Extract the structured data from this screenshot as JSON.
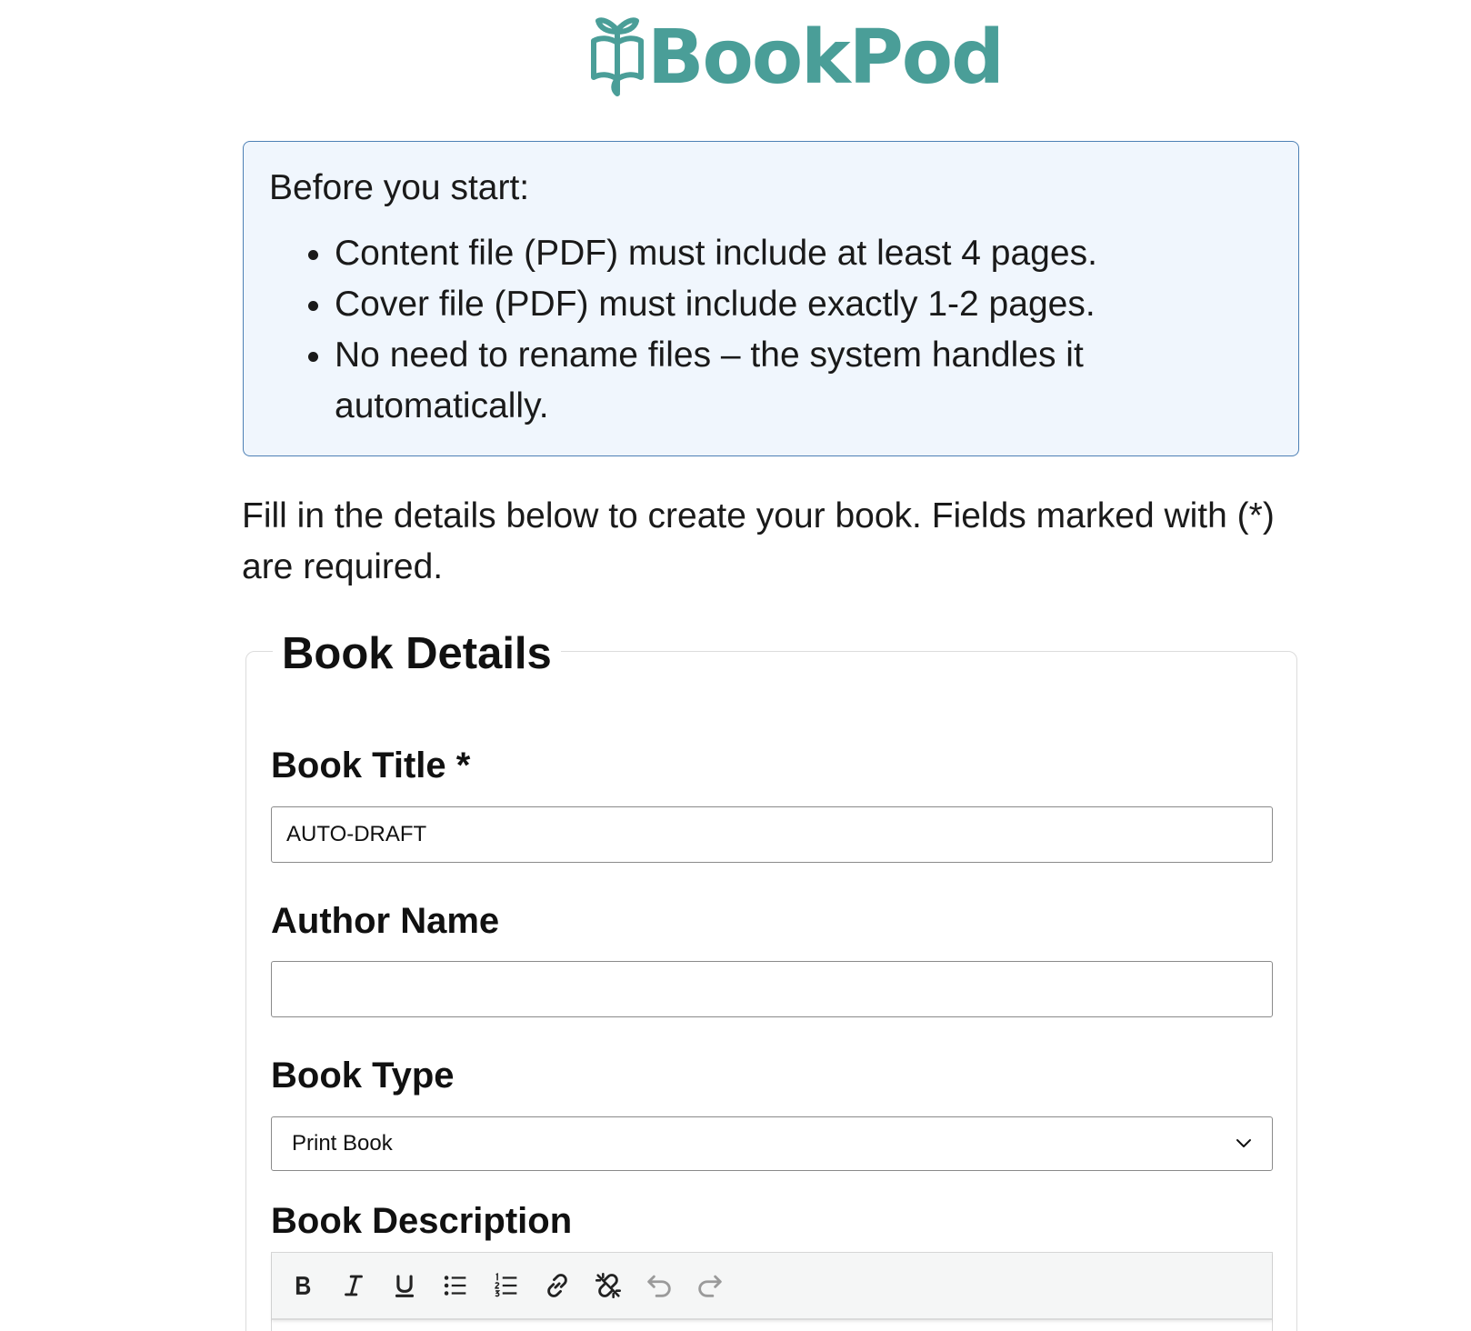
{
  "brand": {
    "name": "BookPod",
    "color": "#4a9e98"
  },
  "notice": {
    "title": "Before you start:",
    "items": [
      "Content file (PDF) must include at least 4 pages.",
      "Cover file (PDF) must include exactly 1-2 pages.",
      "No need to rename files – the system handles it automatically."
    ]
  },
  "intro_text": "Fill in the details below to create your book. Fields marked with (*) are required.",
  "form": {
    "legend": "Book Details",
    "book_title": {
      "label": "Book Title *",
      "value": "AUTO-DRAFT"
    },
    "author_name": {
      "label": "Author Name",
      "value": ""
    },
    "book_type": {
      "label": "Book Type",
      "selected": "Print Book"
    },
    "book_description": {
      "label": "Book Description",
      "toolbar": [
        {
          "name": "bold-icon",
          "enabled": true
        },
        {
          "name": "italic-icon",
          "enabled": true
        },
        {
          "name": "underline-icon",
          "enabled": true
        },
        {
          "name": "bullet-list-icon",
          "enabled": true
        },
        {
          "name": "numbered-list-icon",
          "enabled": true
        },
        {
          "name": "link-icon",
          "enabled": true
        },
        {
          "name": "unlink-icon",
          "enabled": true
        },
        {
          "name": "undo-icon",
          "enabled": false
        },
        {
          "name": "redo-icon",
          "enabled": false
        }
      ]
    }
  }
}
